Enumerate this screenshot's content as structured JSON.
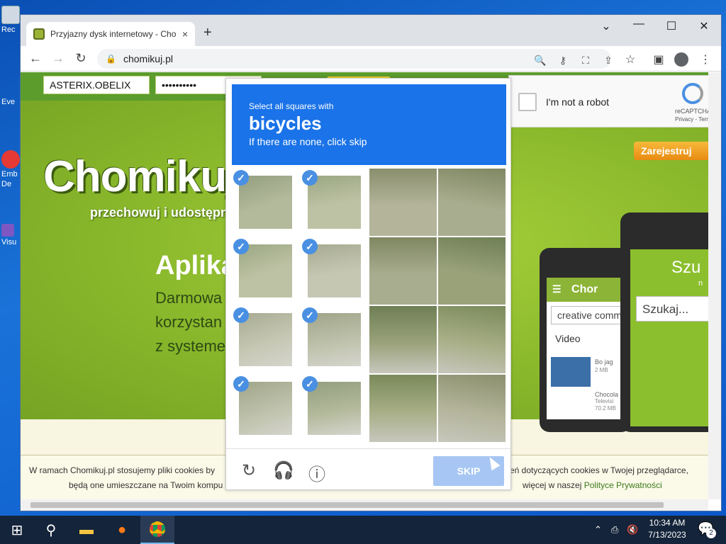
{
  "desktop": {
    "icons": [
      {
        "label": "Rec",
        "icon": "recycle-bin-icon"
      },
      {
        "label": "Eve",
        "icon": "app-shortcut-icon"
      },
      {
        "label": "Emb",
        "icon": "app-shortcut-icon"
      },
      {
        "label": "De",
        "icon": "app-shortcut-icon"
      },
      {
        "label": "Visu",
        "icon": "app-shortcut-icon"
      }
    ]
  },
  "browser": {
    "tab_title": "Przyjazny dysk internetowy - Cho",
    "url": "chomikuj.pl",
    "new_tab_label": "+",
    "close_tab_label": "×"
  },
  "site": {
    "login_value": "ASTERIX.OBELIX",
    "password_value": "••••••••••",
    "logo_text": "Chomikuj.",
    "tagline": "przechowuj i udostępni",
    "app_title": "Aplika",
    "app_lines": [
      "Darmowa",
      "korzystan",
      "z systeme"
    ],
    "register_label": "Zarejestruj",
    "phone_left": {
      "bar": "Chor",
      "search": "creative comm",
      "tab": "Video",
      "item1": "Bo jag",
      "item1_meta": "2 MB",
      "item2": "Chocola",
      "item2_sub": "Televisi",
      "item2_meta": "70.2 MB"
    },
    "phone_right": {
      "bar": "Szu",
      "sub": "n",
      "search": "Szukaj..."
    }
  },
  "recaptcha_widget": {
    "label": "I'm not a robot",
    "brand": "reCAPTCHA",
    "links": "Privacy - Term"
  },
  "challenge": {
    "line1": "Select all squares with",
    "keyword": "bicycles",
    "line3": "If there are none, click skip",
    "selected_tiles": [
      0,
      1,
      4,
      5,
      8,
      9,
      12,
      13
    ],
    "skip_label": "SKIP"
  },
  "cookie_banner": {
    "line1_left": "W ramach Chomikuj.pl stosujemy pliki cookies by",
    "line1_right": "eń dotyczących cookies w Twojej przeglądarce,",
    "line2_left": "będą one umieszczane na Twoim kompu",
    "line2_right": "więcej w naszej",
    "link": "Polityce Prywatności"
  },
  "taskbar": {
    "time": "10:34 AM",
    "date": "7/13/2023",
    "notifications": "2"
  },
  "colors": {
    "captcha_blue": "#1a73e8",
    "site_green": "#86b52a",
    "register_orange": "#e88b12",
    "skip_disabled": "#a7c6f3"
  }
}
